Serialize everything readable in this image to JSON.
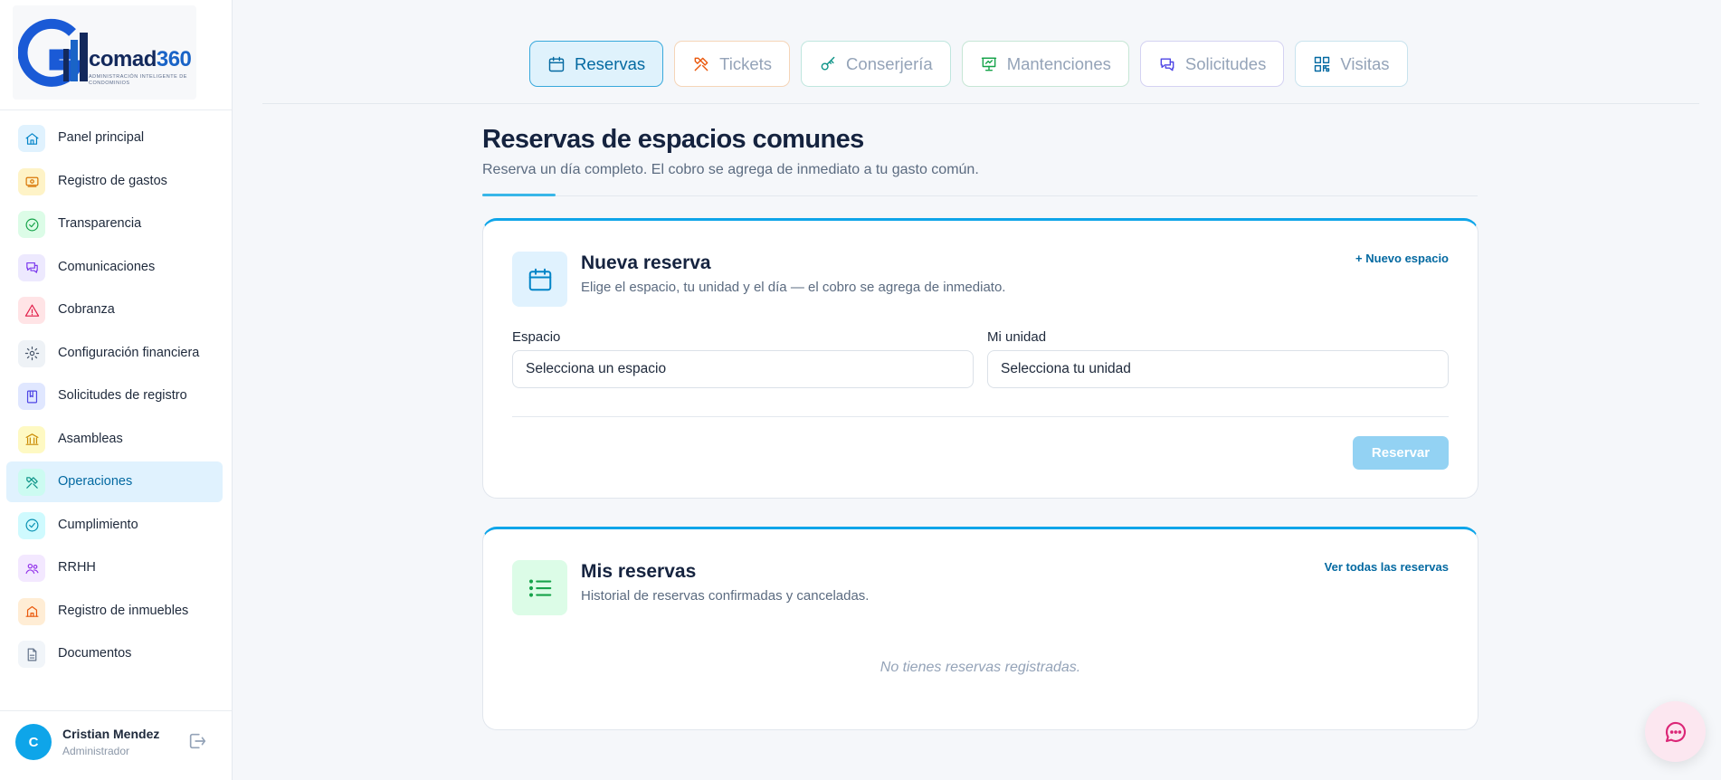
{
  "brand": {
    "name_main": "comad",
    "name_num": "360",
    "tagline": "Administración inteligente de condominios"
  },
  "sidebar": {
    "items": [
      {
        "label": "Panel principal",
        "icon": "home-icon",
        "color": "#0284c7",
        "bg": "#e0f2fe"
      },
      {
        "label": "Registro de gastos",
        "icon": "money-icon",
        "color": "#d97706",
        "bg": "#fef3c7"
      },
      {
        "label": "Transparencia",
        "icon": "check-circle-icon",
        "color": "#16a34a",
        "bg": "#dcfce7"
      },
      {
        "label": "Comunicaciones",
        "icon": "chat-icon",
        "color": "#7c3aed",
        "bg": "#ede9fe"
      },
      {
        "label": "Cobranza",
        "icon": "alert-triangle-icon",
        "color": "#e11d48",
        "bg": "#ffe4e6"
      },
      {
        "label": "Configuración financiera",
        "icon": "gear-icon",
        "color": "#475569",
        "bg": "#eef2f6"
      },
      {
        "label": "Solicitudes de registro",
        "icon": "book-icon",
        "color": "#4f46e5",
        "bg": "#e0e7ff"
      },
      {
        "label": "Asambleas",
        "icon": "bank-icon",
        "color": "#ca8a04",
        "bg": "#fef9c3"
      },
      {
        "label": "Operaciones",
        "icon": "tools-icon",
        "color": "#0d9488",
        "bg": "#ccfbf1"
      },
      {
        "label": "Cumplimiento",
        "icon": "check-circle-icon",
        "color": "#0891b2",
        "bg": "#cffafe"
      },
      {
        "label": "RRHH",
        "icon": "people-icon",
        "color": "#9333ea",
        "bg": "#f3e8ff"
      },
      {
        "label": "Registro de inmuebles",
        "icon": "building-icon",
        "color": "#ea580c",
        "bg": "#ffedd5"
      },
      {
        "label": "Documentos",
        "icon": "document-icon",
        "color": "#64748b",
        "bg": "#f1f5f9"
      }
    ],
    "active": "Operaciones"
  },
  "user": {
    "initial": "C",
    "name": "Cristian Mendez",
    "role": "Administrador"
  },
  "tabs": [
    {
      "label": "Reservas",
      "icon": "calendar-icon",
      "active": true,
      "color": "#0369a1"
    },
    {
      "label": "Tickets",
      "icon": "tools-icon",
      "active": false,
      "color": "#ea580c"
    },
    {
      "label": "Conserjería",
      "icon": "key-icon",
      "active": false,
      "color": "#0d9488"
    },
    {
      "label": "Mantenciones",
      "icon": "presentation-icon",
      "active": false,
      "color": "#16a34a"
    },
    {
      "label": "Solicitudes",
      "icon": "chat-icon",
      "active": false,
      "color": "#4f46e5"
    },
    {
      "label": "Visitas",
      "icon": "qr-icon",
      "active": false,
      "color": "#0369a1"
    }
  ],
  "page": {
    "title": "Reservas de espacios comunes",
    "subtitle": "Reserva un día completo. El cobro se agrega de inmediato a tu gasto común."
  },
  "new_booking": {
    "title": "Nueva reserva",
    "description": "Elige el espacio, tu unidad y el día — el cobro se agrega de inmediato.",
    "add_space_link": "+ Nuevo espacio",
    "space_label": "Espacio",
    "space_value": "Selecciona un espacio",
    "unit_label": "Mi unidad",
    "unit_value": "Selecciona tu unidad",
    "submit": "Reservar"
  },
  "my_bookings": {
    "title": "Mis reservas",
    "description": "Historial de reservas confirmadas y canceladas.",
    "view_all_link": "Ver todas las reservas",
    "empty_text": "No tienes reservas registradas."
  },
  "colors": {
    "accent": "#0ea5e9",
    "brand_dark": "#13295c",
    "chat_fab": "#db2777"
  }
}
